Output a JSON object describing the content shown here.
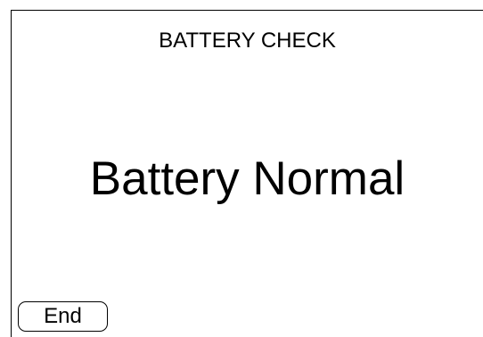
{
  "header": {
    "title": "BATTERY CHECK"
  },
  "main": {
    "status": "Battery Normal"
  },
  "footer": {
    "end_label": "End"
  },
  "colors": {
    "background": "#ffffff",
    "foreground": "#000000"
  }
}
